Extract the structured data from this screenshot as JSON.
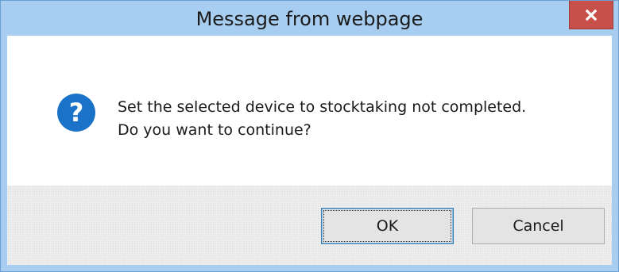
{
  "dialog": {
    "title": "Message from webpage",
    "close_icon": "close-icon",
    "message_icon": "question-icon",
    "message_lines": [
      "Set the selected device to stocktaking not completed.",
      "Do you want to continue?"
    ],
    "ok_label": "OK",
    "cancel_label": "Cancel"
  },
  "colors": {
    "titlebar": "#a7cdf0",
    "close_button": "#c7504a",
    "question_icon": "#1a73c8"
  }
}
